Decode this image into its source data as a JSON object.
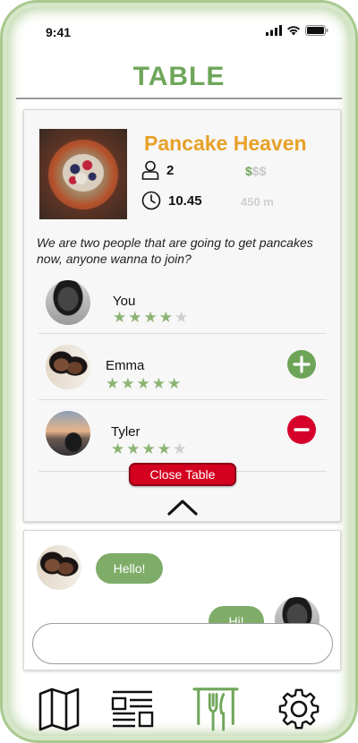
{
  "status_bar": {
    "time": "9:41"
  },
  "app": {
    "title": "TABLE"
  },
  "table": {
    "restaurant_name": "Pancake Heaven",
    "people_count": "2",
    "time": "10.45",
    "price_level": {
      "filled": "$",
      "empty": "$$"
    },
    "distance": "450 m",
    "description": "We are two people that are going to get pancakes now, anyone wanna to join?",
    "members": [
      {
        "name": "You",
        "rating": 4,
        "max_rating": 5,
        "action": "none"
      },
      {
        "name": "Emma",
        "rating": 5,
        "max_rating": 5,
        "action": "add"
      },
      {
        "name": "Tyler",
        "rating": 4,
        "max_rating": 5,
        "action": "remove"
      }
    ],
    "close_button": "Close Table"
  },
  "chat": {
    "messages": [
      {
        "from": "Emma",
        "text": "Hello!"
      },
      {
        "from": "You",
        "text": "Hi!"
      }
    ],
    "input_placeholder": ""
  },
  "nav": {
    "items": [
      "map-icon",
      "list-icon",
      "table-icon",
      "gear-icon"
    ],
    "active": "table-icon"
  },
  "colors": {
    "brand_green": "#6fa65a",
    "title_orange": "#e7a129",
    "remove_red": "#d6002a",
    "close_red": "#d4001f",
    "bubble_green": "#7fad69"
  }
}
